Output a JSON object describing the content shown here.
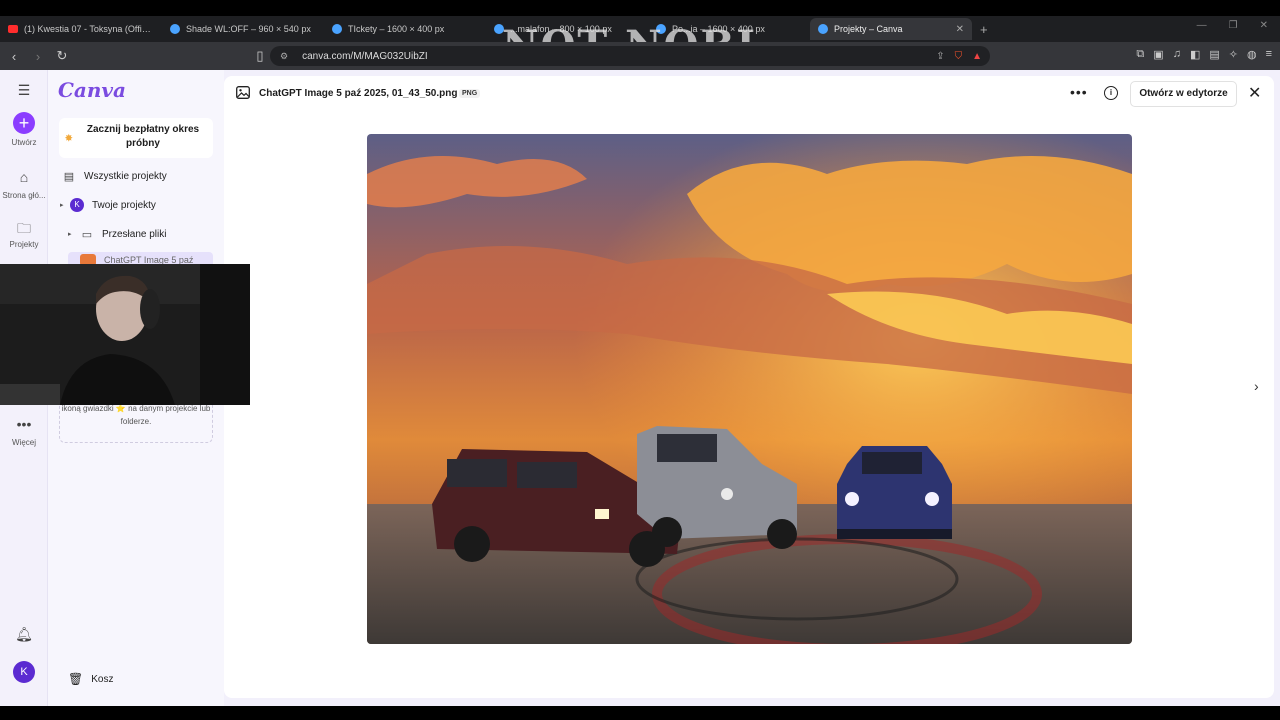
{
  "browser": {
    "tabs": [
      {
        "label": "(1) Kwestia 07 - Toksyna (Official",
        "favicon_color": "#ff2d2d",
        "active": false
      },
      {
        "label": "Shade WL:OFF – 960 × 540 px",
        "favicon_color": "#4aa3ff",
        "active": false
      },
      {
        "label": "TIckety – 1600 × 400 px",
        "favicon_color": "#4aa3ff",
        "active": false
      },
      {
        "label": "...malafon – 800 × 100 px",
        "favicon_color": "#4aa3ff",
        "active": false
      },
      {
        "label": "Po...ia – 1600 × 400 px",
        "favicon_color": "#4aa3ff",
        "active": false
      },
      {
        "label": "Projekty – Canva",
        "favicon_color": "#4aa3ff",
        "active": true
      }
    ],
    "watermark": "NOT NOBI",
    "url": "canva.com/M/MAG032UibZI"
  },
  "rail": {
    "create": "Utwórz",
    "home": "Strona głó...",
    "projects": "Projekty",
    "more": "Więcej",
    "avatar": "K"
  },
  "sidebar": {
    "logo": "Canva",
    "trial": "Zacznij bezpłatny okres próbny",
    "all_projects": "Wszystkie projekty",
    "your_projects": "Twoje projekty",
    "uploads": "Przesłane pliki",
    "selected_file": "ChatGPT Image 5 paź",
    "hint": "ikoną gwiazdki ⭐ na danym projekcie lub folderze.",
    "trash": "Kosz",
    "avatar": "K"
  },
  "viewer": {
    "filename": "ChatGPT Image 5 paź 2025, 01_43_50.png",
    "badge": "PNG",
    "open_label": "Otwórz w edytorze"
  }
}
